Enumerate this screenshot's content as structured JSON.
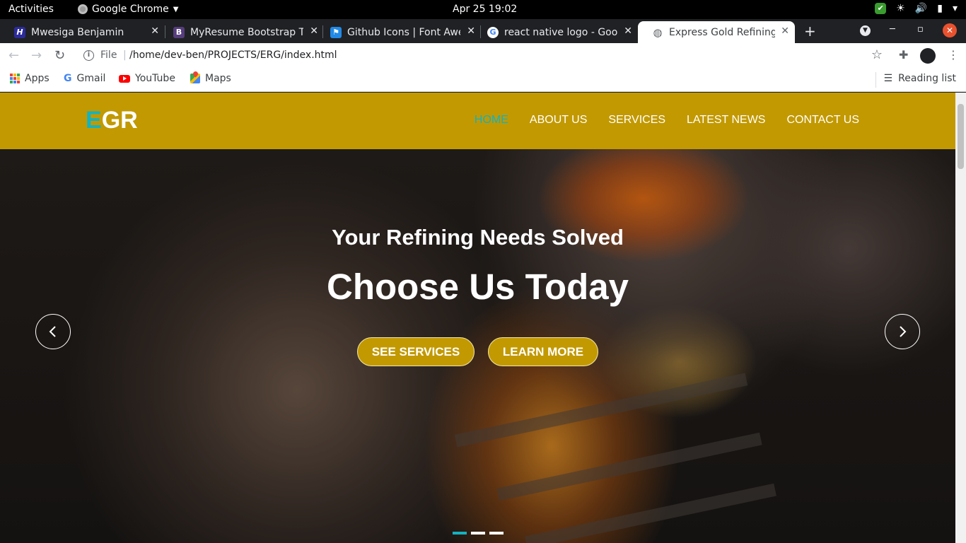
{
  "os": {
    "activities": "Activities",
    "app_name": "Google Chrome",
    "clock": "Apr 25  19:02"
  },
  "browser": {
    "tabs": [
      {
        "title": "Mwesiga Benjamin",
        "favicon_color": "#2b2b9b",
        "favicon_letter": "H"
      },
      {
        "title": "MyResume Bootstrap T",
        "favicon_color": "#563d7c",
        "favicon_letter": "B"
      },
      {
        "title": "Github Icons | Font Awe",
        "favicon_color": "#228ae6",
        "favicon_letter": "⚑"
      },
      {
        "title": "react native logo - Goog",
        "favicon_color": "#ffffff",
        "favicon_letter": "G"
      },
      {
        "title": "Express Gold Refining L",
        "favicon_color": "#5f6368",
        "favicon_letter": "◍",
        "active": true
      }
    ],
    "omnibox": {
      "scheme": "File",
      "url": "/home/dev-ben/PROJECTS/ERG/index.html"
    },
    "bookmarks": [
      {
        "label": "Apps",
        "icon": "apps-grid-icon"
      },
      {
        "label": "Gmail",
        "icon": "google-icon"
      },
      {
        "label": "YouTube",
        "icon": "youtube-icon"
      },
      {
        "label": "Maps",
        "icon": "maps-icon"
      }
    ],
    "reading_list": "Reading list"
  },
  "site": {
    "logo_accent": "E",
    "logo_rest": "GR",
    "nav": [
      "HOME",
      "ABOUT US",
      "SERVICES",
      "LATEST NEWS",
      "CONTACT US"
    ],
    "active_nav": "HOME",
    "colors": {
      "brand": "#c29900",
      "accent": "#12b3c0"
    },
    "hero": {
      "subtitle": "Your Refining Needs Solved",
      "title": "Choose Us Today",
      "buttons": [
        "SEE SERVICES",
        "LEARN MORE"
      ],
      "slide_count": 3,
      "active_slide": 1
    }
  }
}
